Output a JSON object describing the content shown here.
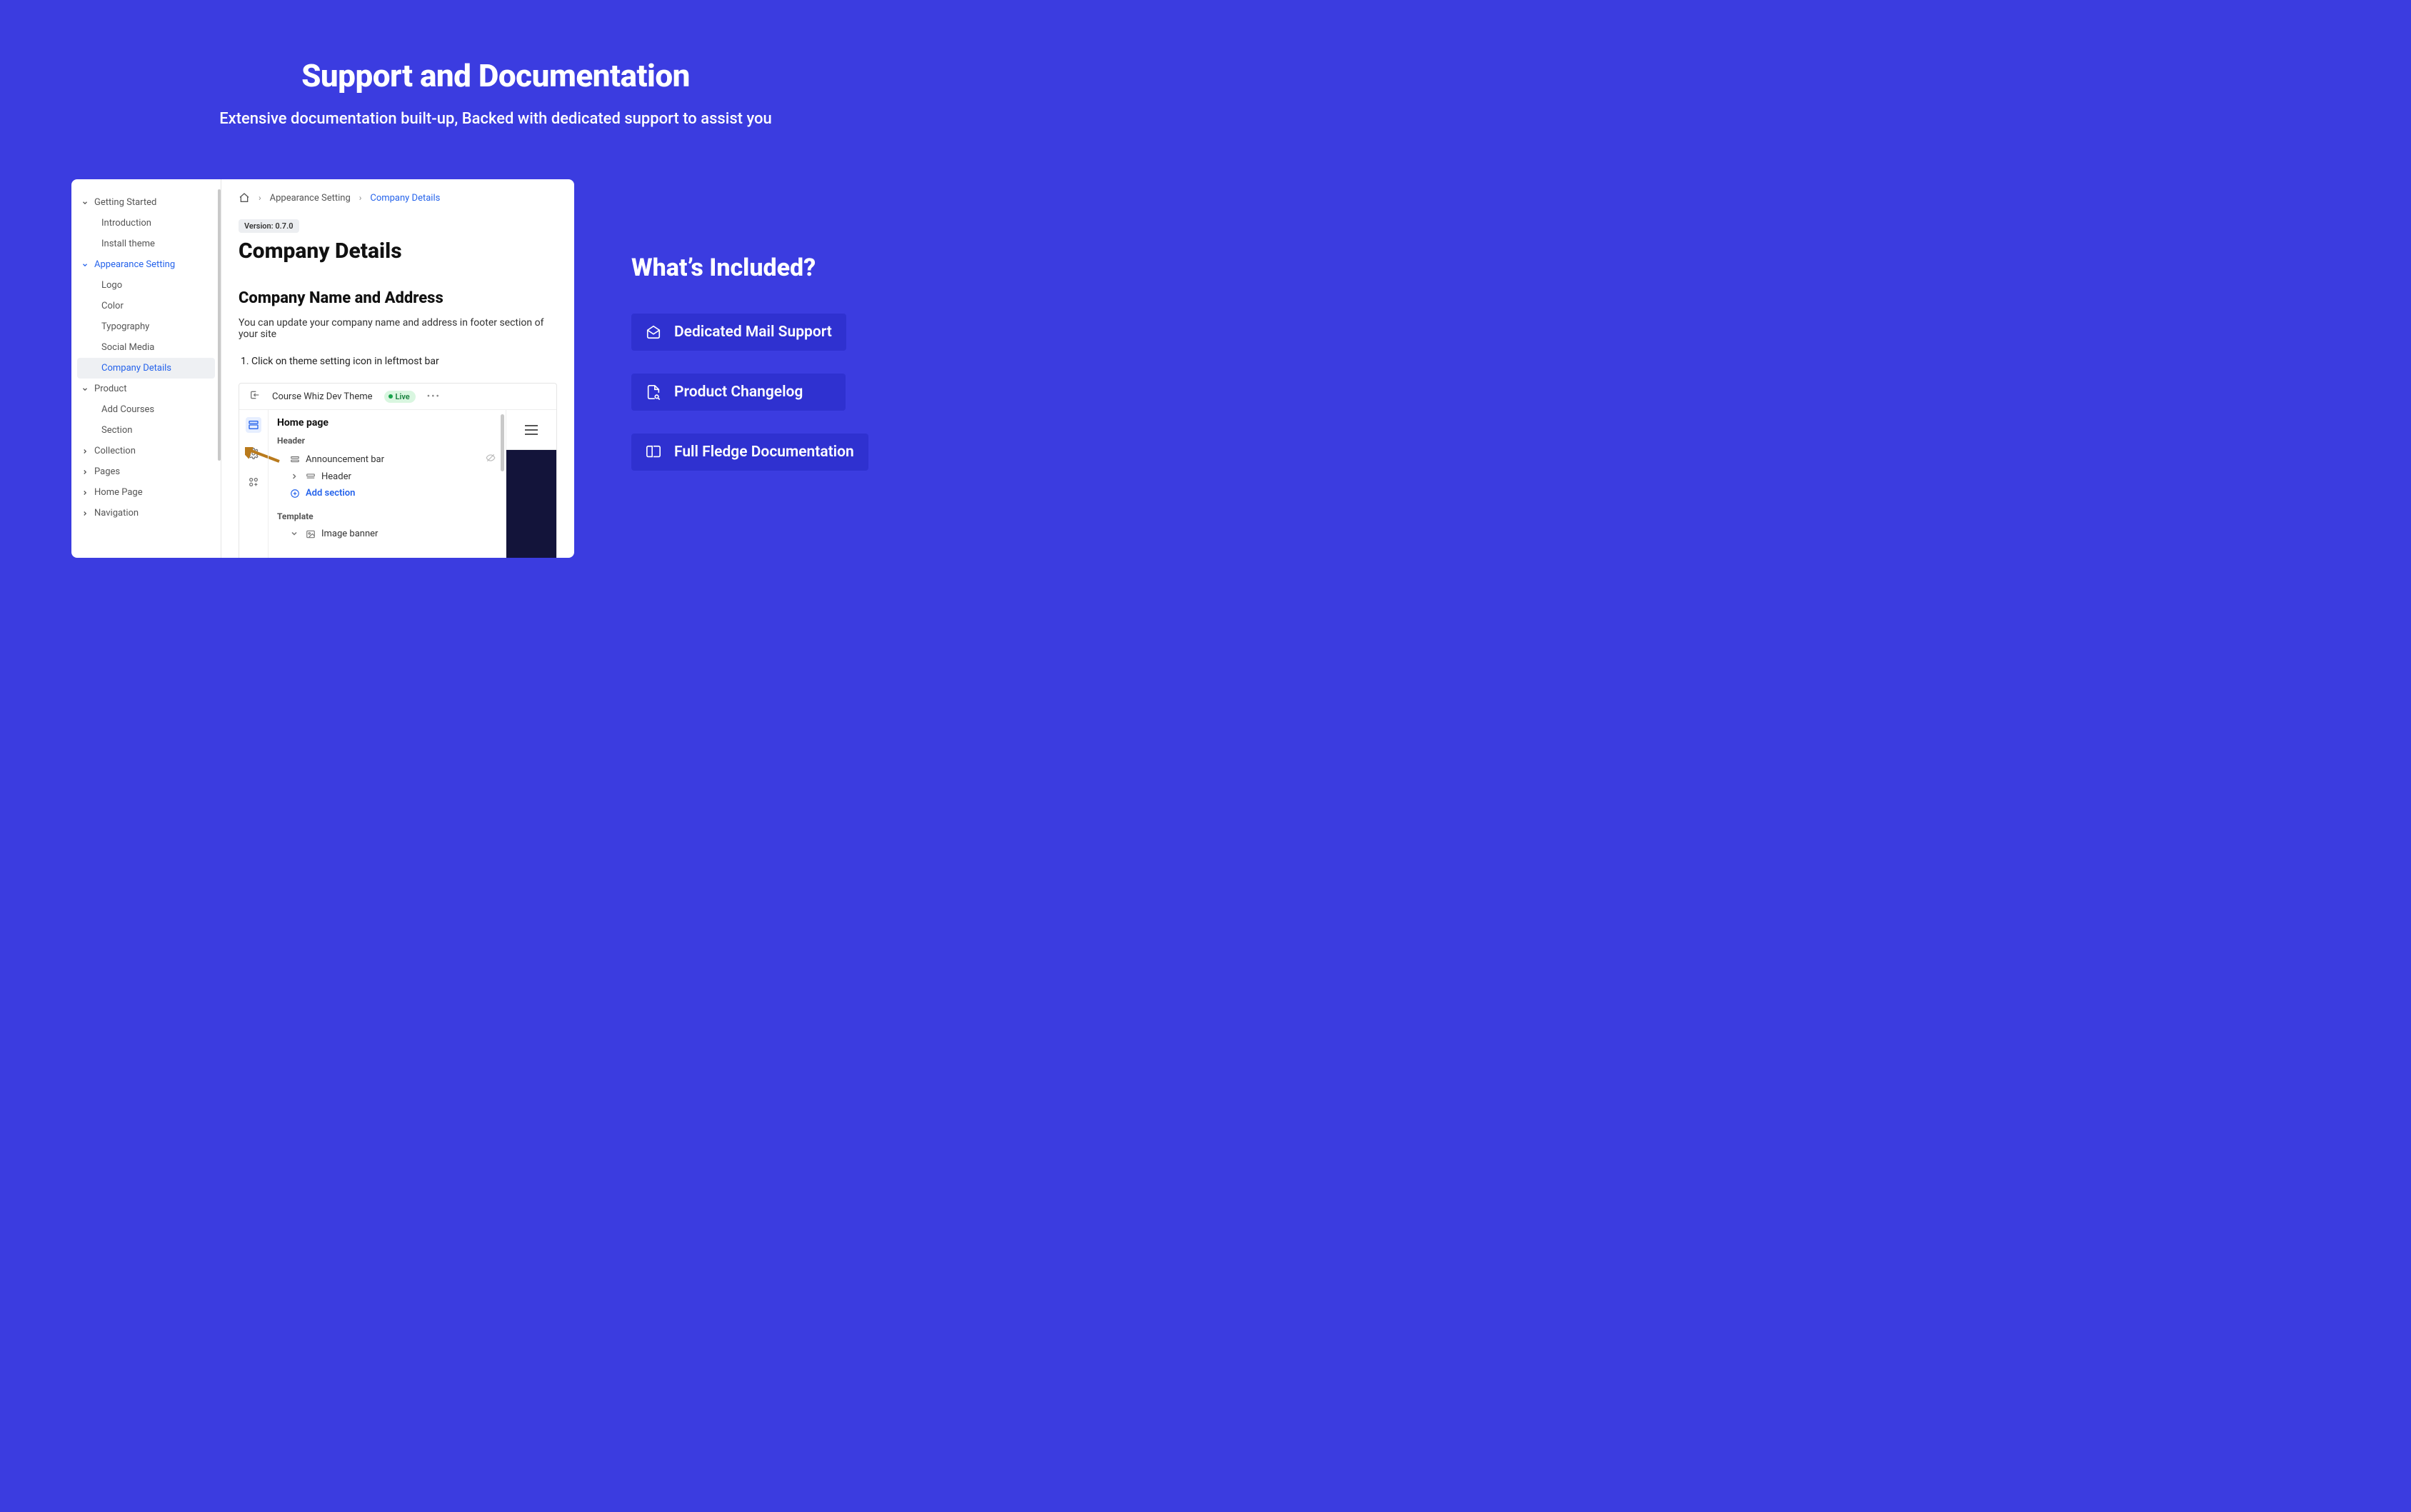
{
  "hero": {
    "title": "Support and Documentation",
    "subtitle": "Extensive documentation built-up, Backed with dedicated support to assist you"
  },
  "sidebar": {
    "groups": [
      {
        "label": "Getting Started",
        "expanded": true,
        "children": [
          "Introduction",
          "Install theme"
        ]
      },
      {
        "label": "Appearance Setting",
        "expanded": true,
        "active": true,
        "children": [
          "Logo",
          "Color",
          "Typography",
          "Social Media",
          "Company Details"
        ],
        "selected_child": "Company Details"
      },
      {
        "label": "Product",
        "expanded": true,
        "children": [
          "Add Courses",
          "Section"
        ]
      },
      {
        "label": "Collection",
        "expanded": false
      },
      {
        "label": "Pages",
        "expanded": false
      },
      {
        "label": "Home Page",
        "expanded": false
      },
      {
        "label": "Navigation",
        "expanded": false
      }
    ]
  },
  "breadcrumb": {
    "section": "Appearance Setting",
    "page": "Company Details"
  },
  "doc": {
    "version_label": "Version: 0.7.0",
    "title": "Company Details",
    "h2": "Company Name and Address",
    "p": "You can update your company name and address in footer section of your site",
    "step1": "Click on theme setting icon in leftmost bar"
  },
  "editor": {
    "theme_name": "Course Whiz Dev Theme",
    "live_label": "Live",
    "tree_title": "Home page",
    "group_header": "Header",
    "announcement": "Announcement bar",
    "header_item": "Header",
    "add_section": "Add section",
    "template_label": "Template",
    "image_banner": "Image banner"
  },
  "included": {
    "heading": "What’s Included?",
    "items": [
      {
        "icon": "mail-open",
        "label": "Dedicated Mail Support"
      },
      {
        "icon": "file-search",
        "label": "Product Changelog"
      },
      {
        "icon": "book-open",
        "label": "Full Fledge Documentation"
      }
    ]
  }
}
